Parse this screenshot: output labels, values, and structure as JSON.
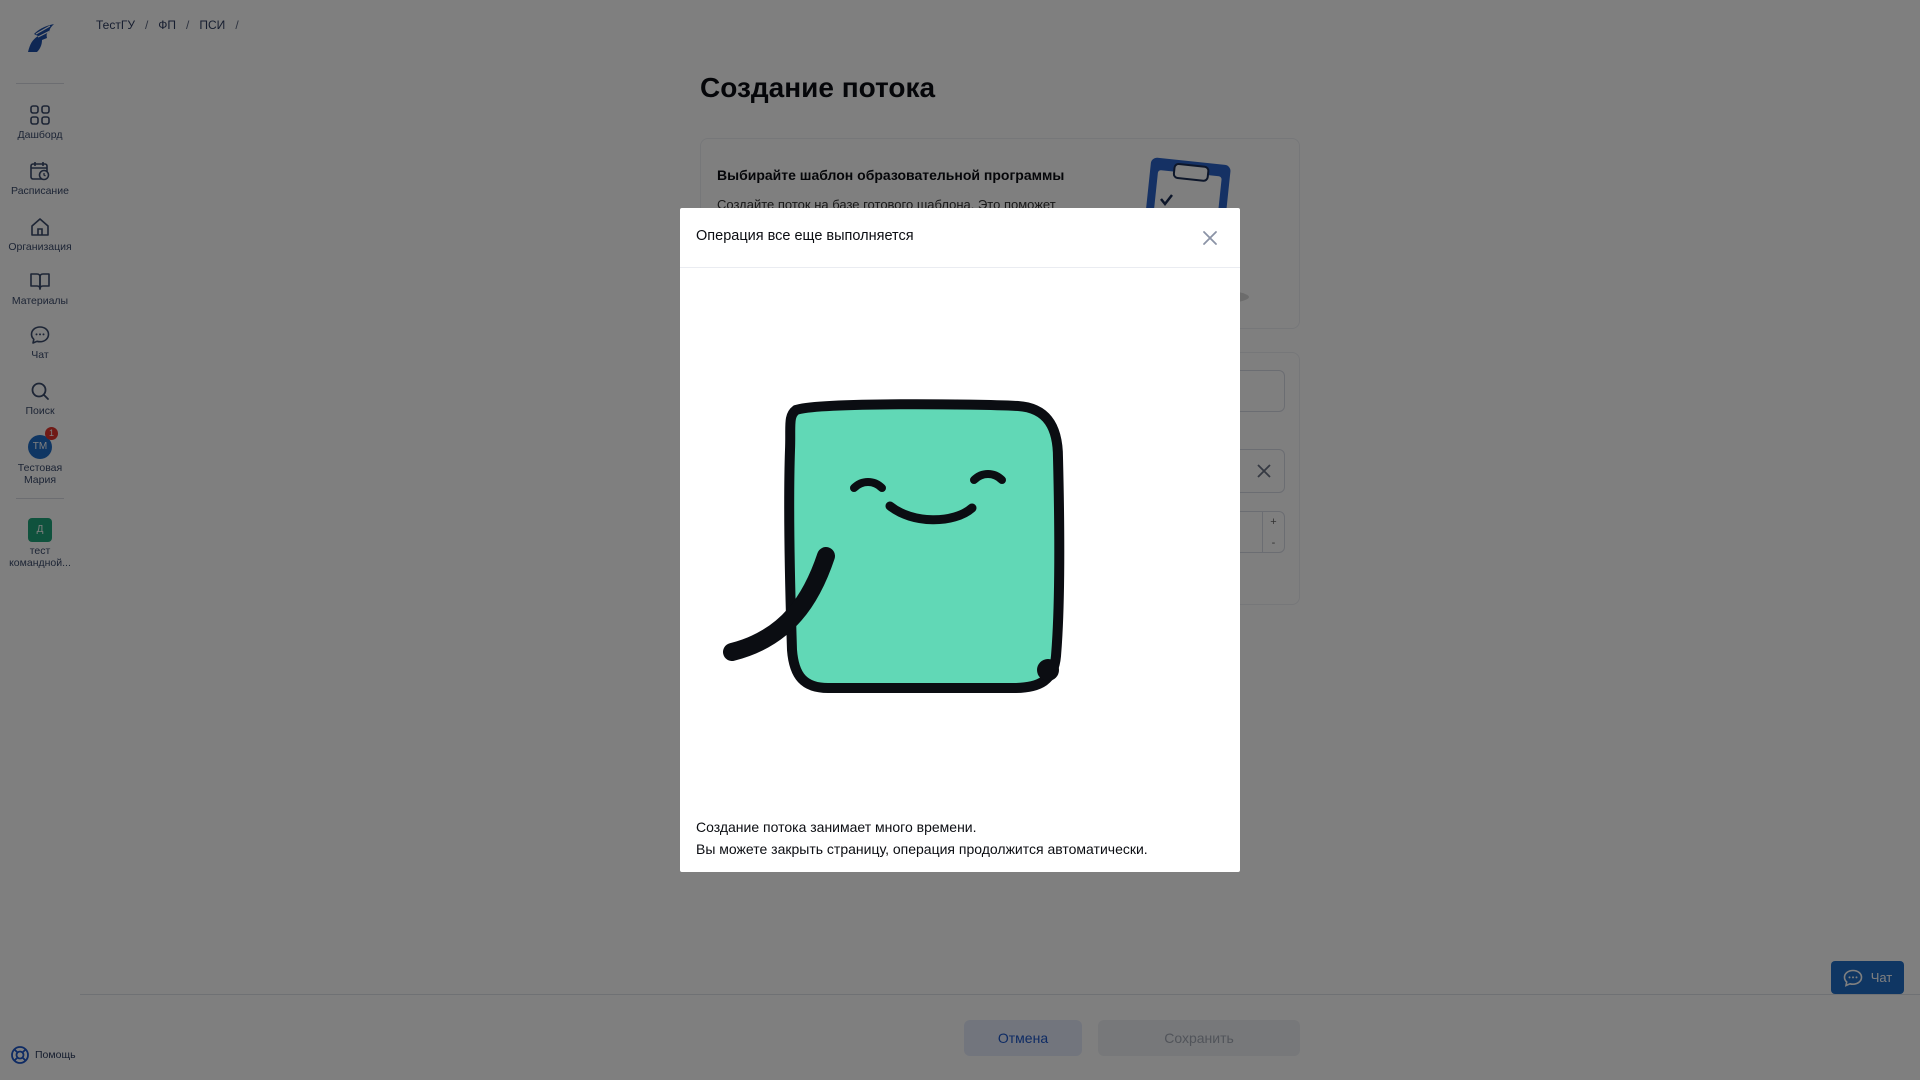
{
  "sidebar": {
    "logo_icon": "knight-logo-icon",
    "items": [
      {
        "label": "Дашборд",
        "icon": "dashboard-grid-icon"
      },
      {
        "label": "Расписание",
        "icon": "calendar-clock-icon"
      },
      {
        "label": "Организация",
        "icon": "home-icon"
      },
      {
        "label": "Материалы",
        "icon": "book-icon"
      },
      {
        "label": "Чат",
        "icon": "chat-bubble-icon"
      },
      {
        "label": "Поиск",
        "icon": "search-icon"
      }
    ],
    "user": {
      "initials": "ТМ",
      "badge": "1",
      "name_line1": "Тестовая",
      "name_line2": "Мария"
    },
    "team": {
      "initial": "Д",
      "name_line1": "тест",
      "name_line2": "командной..."
    },
    "help_label": "Помощь"
  },
  "breadcrumb": [
    "ТестГУ",
    "ФП",
    "ПСИ"
  ],
  "breadcrumb_separator": "/",
  "page": {
    "title": "Создание потока",
    "template_card": {
      "title": "Выбирайте шаблон образовательной программы",
      "text": "Создайте поток на базе готового шаблона. Это поможет"
    }
  },
  "footer": {
    "cancel_label": "Отмена",
    "save_label": "Сохранить"
  },
  "chat_fab": {
    "label": "Чат"
  },
  "modal": {
    "title": "Операция все еще выполняется",
    "text_line1": "Создание потока занимает много времени.",
    "text_line2": "Вы можете закрыть страницу, операция продолжится автоматически."
  },
  "colors": {
    "accent": "#1f6cc7",
    "illustration_fill": "#61d8b6",
    "overlay": "rgba(0,0,0,0.5)"
  }
}
